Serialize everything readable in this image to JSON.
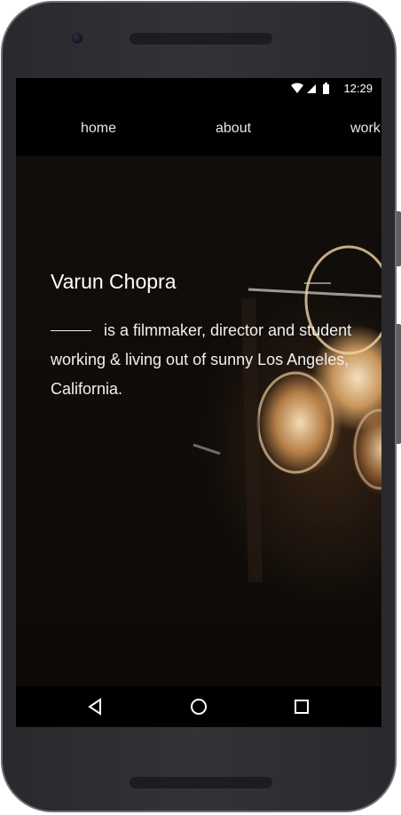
{
  "status_bar": {
    "time": "12:29",
    "icons": [
      "wifi-icon",
      "signal-icon",
      "battery-icon"
    ]
  },
  "nav": {
    "items": [
      {
        "label": "home"
      },
      {
        "label": "about"
      },
      {
        "label": "work"
      }
    ]
  },
  "intro": {
    "name": "Varun Chopra",
    "description": "is a filmmaker, director and student working & living out of sunny Los Angeles, California."
  },
  "system_nav": {
    "icons": [
      "back-icon",
      "home-icon",
      "recents-icon"
    ]
  },
  "colors": {
    "screen_background": "#0d0a08",
    "bar_background": "#000000",
    "text": "#ffffff",
    "phone_body": "#2e2d31"
  }
}
